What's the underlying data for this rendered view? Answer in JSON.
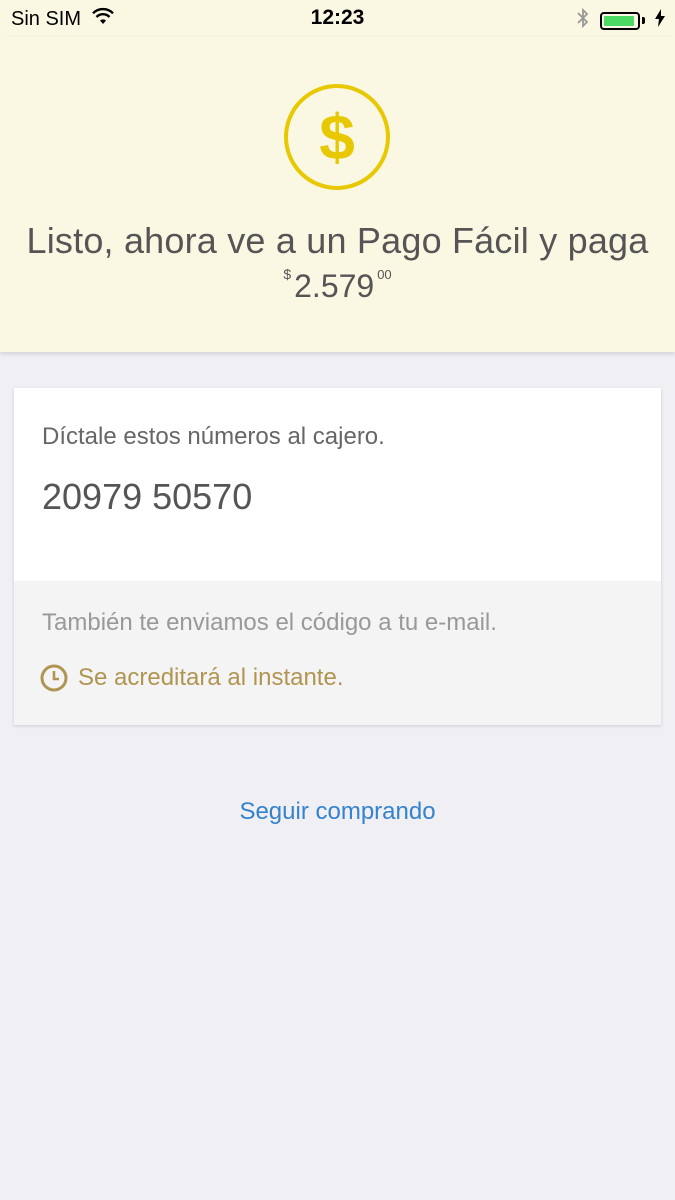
{
  "status_bar": {
    "carrier": "Sin SIM",
    "time": "12:23",
    "battery_level": 0.95,
    "battery_color": "#4cd964"
  },
  "header": {
    "icon": "dollar-coin-icon",
    "accent_color": "#e8c800",
    "headline": "Listo, ahora ve a un Pago Fácil y paga",
    "amount": {
      "currency": "$",
      "integer": "2.579",
      "decimals": "00"
    }
  },
  "card": {
    "instruction": "Díctale estos números al cajero.",
    "code": "20979 50570",
    "email_note": "También te enviamos el código a tu e-mail.",
    "credit_note": "Se acreditará al instante.",
    "credit_icon": "clock-icon",
    "credit_color": "#b09552"
  },
  "actions": {
    "continue_label": "Seguir comprando",
    "link_color": "#3483cc"
  }
}
